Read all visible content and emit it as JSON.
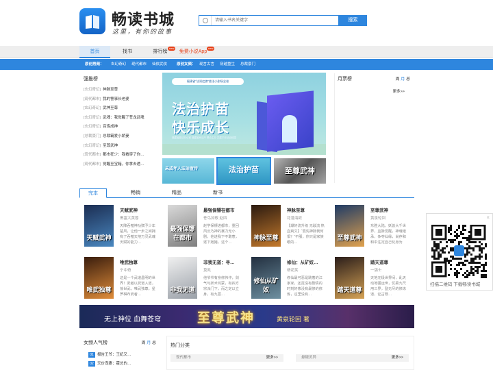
{
  "header": {
    "brand_name": "畅读书城",
    "slogan": "这里，有你的故事",
    "search_placeholder": "请输入书名关键字",
    "search_button": "搜索"
  },
  "nav": {
    "items": [
      {
        "label": "首页",
        "badge": ""
      },
      {
        "label": "找书",
        "badge": ""
      },
      {
        "label": "排行榜",
        "badge": "new"
      },
      {
        "label": "免费小说App",
        "badge": "new"
      }
    ]
  },
  "subnav": {
    "male_label": "原创男频：",
    "male_items": [
      "玄幻奇幻",
      "现代都市",
      "仙侠武侠"
    ],
    "female_label": "原创女频：",
    "female_items": [
      "现言古言",
      "穿越重生",
      "总裁豪门"
    ]
  },
  "rank": {
    "title": "强推榜",
    "items": [
      {
        "cat": "[玄幻奇幻]",
        "name": "神脉至尊"
      },
      {
        "cat": "[现代都市]",
        "name": "我的警事长老婆"
      },
      {
        "cat": "[玄幻奇幻]",
        "name": "武神至尊"
      },
      {
        "cat": "[玄幻奇幻]",
        "name": "武魂：我觉醒了苍龙武魂"
      },
      {
        "cat": "[玄幻奇幻]",
        "name": "百炼成神"
      },
      {
        "cat": "[总裁豪门]",
        "name": "总裁霸爱小娇妻"
      },
      {
        "cat": "[玄幻奇幻]",
        "name": "至尊武神"
      },
      {
        "cat": "[现代都市]",
        "name": "都市狂少：我看穿了你…"
      },
      {
        "cat": "[现代都市]",
        "name": "觉醒至宝箱，你拿去透…"
      }
    ]
  },
  "banner": {
    "top_text": "福建省“法润红旗”普法小剧场全省",
    "line1": "法治护苗",
    "line2": "快乐成长",
    "small": "福建省普法办公室 福建省司法厅 联合主办 共建平安法治校园",
    "thumbs": [
      {
        "text": "未成年人法治宣传"
      },
      {
        "text": "法治护苗"
      },
      {
        "text": "至尊武神"
      }
    ]
  },
  "month_rank": {
    "title": "月票榜",
    "tabs": [
      "周",
      "月",
      "总"
    ],
    "active_tab": "月",
    "more": "更多>>"
  },
  "book_tabs": {
    "items": [
      "完本",
      "畅销",
      "精品",
      "新书"
    ],
    "active": "完本"
  },
  "books": [
    {
      "title": "天赋武神",
      "author": "黑塞大黄蓉",
      "desc": "天降吞噬神功赋予少年楚风，让他一步之间拥有了吞噬天地万灵武魂天赋的能力…",
      "cover_text": "天赋武神",
      "c1": "#1b2d52",
      "c2": "#4a88c0"
    },
    {
      "title": "最强保镖在都市",
      "author": "苍鸟如歌 赵四",
      "desc": "赵学保镖进都市，重回风云乃神的暴力无小剧，他进我下不敢惹，逐下她猪，这个…",
      "cover_text": "最强保镖在都市",
      "c1": "#d9d9d9",
      "c2": "#7f7f7f"
    },
    {
      "title": "神脉至尊",
      "author": "花落海欲",
      "desc": "【爆好流升级 无敌流 热血爽文】“混沌神脉我何惧？“不服，你只是家族眼的…",
      "cover_text": "神脉至尊",
      "c1": "#2b1a10",
      "c2": "#c47a2c"
    },
    {
      "title": "至尊武神",
      "author": "黄泉轮回",
      "desc": "东胜大陆，妖兽大千世界，血脉觉醒，神魂继承，争夺仙缘，尚存和和中注定自己化身为皇…",
      "cover_text": "至尊武神",
      "c1": "#1f3b66",
      "c2": "#e1a24e"
    },
    {
      "title": "唯武独尊",
      "author": "宁中奇",
      "desc": "这是一个武道昌明的世界！武者以武道入道，惊世武，唯武独尊，星罗棋布武者…",
      "cover_text": "唯武独尊",
      "c1": "#3a1d0d",
      "c2": "#e08d3a"
    },
    {
      "title": "非我无道：寻…",
      "author": "莫凯",
      "desc": "他爷爷有身修伟作，剑气与妖术鸿蒙，有四方宗派门下，而之定以立身，有九层…",
      "cover_text": "非我无道",
      "c1": "#f0f0f0",
      "c2": "#9aa0a8"
    },
    {
      "title": "修仙：从矿奴…",
      "author": "杨花笑",
      "desc": "修仙最可恶是跳着的江家家，还竟没有剧情的时刻好像没有最惨的修炼，这里没有…",
      "cover_text": "修仙从矿奴",
      "c1": "#233040",
      "c2": "#6d8fa0"
    },
    {
      "title": "踏天道尊",
      "author": "一强士",
      "desc": "天地无极世界间，乱天动地强运世，优柔九尺用三界，登无尽的修炼道，证古尊…",
      "cover_text": "踏天道尊",
      "c1": "#2b1e1a",
      "c2": "#d5a255"
    }
  ],
  "ad": {
    "t1": "无上神位 血舞苍穹",
    "t2": "至尊武神",
    "t3": "黄泉轮回 著"
  },
  "female_rank": {
    "title": "女频人气榜",
    "tabs": [
      "周",
      "月",
      "总"
    ],
    "active_tab": "月",
    "items": [
      {
        "num": "01",
        "name": "报告王爷：王妃又…"
      },
      {
        "num": "02",
        "name": "天价宠妻：霍总的…"
      }
    ]
  },
  "hot": {
    "title": "热门分类",
    "bars": [
      {
        "label": "现代都市",
        "more": "更多>>"
      },
      {
        "label": "悬疑灵异",
        "more": "更多>>"
      }
    ]
  },
  "qr": {
    "close": "×",
    "caption": "扫描二维码 下载畅读书城"
  },
  "colors": {
    "accent": "#2e86de",
    "badge": "#e8431a"
  }
}
